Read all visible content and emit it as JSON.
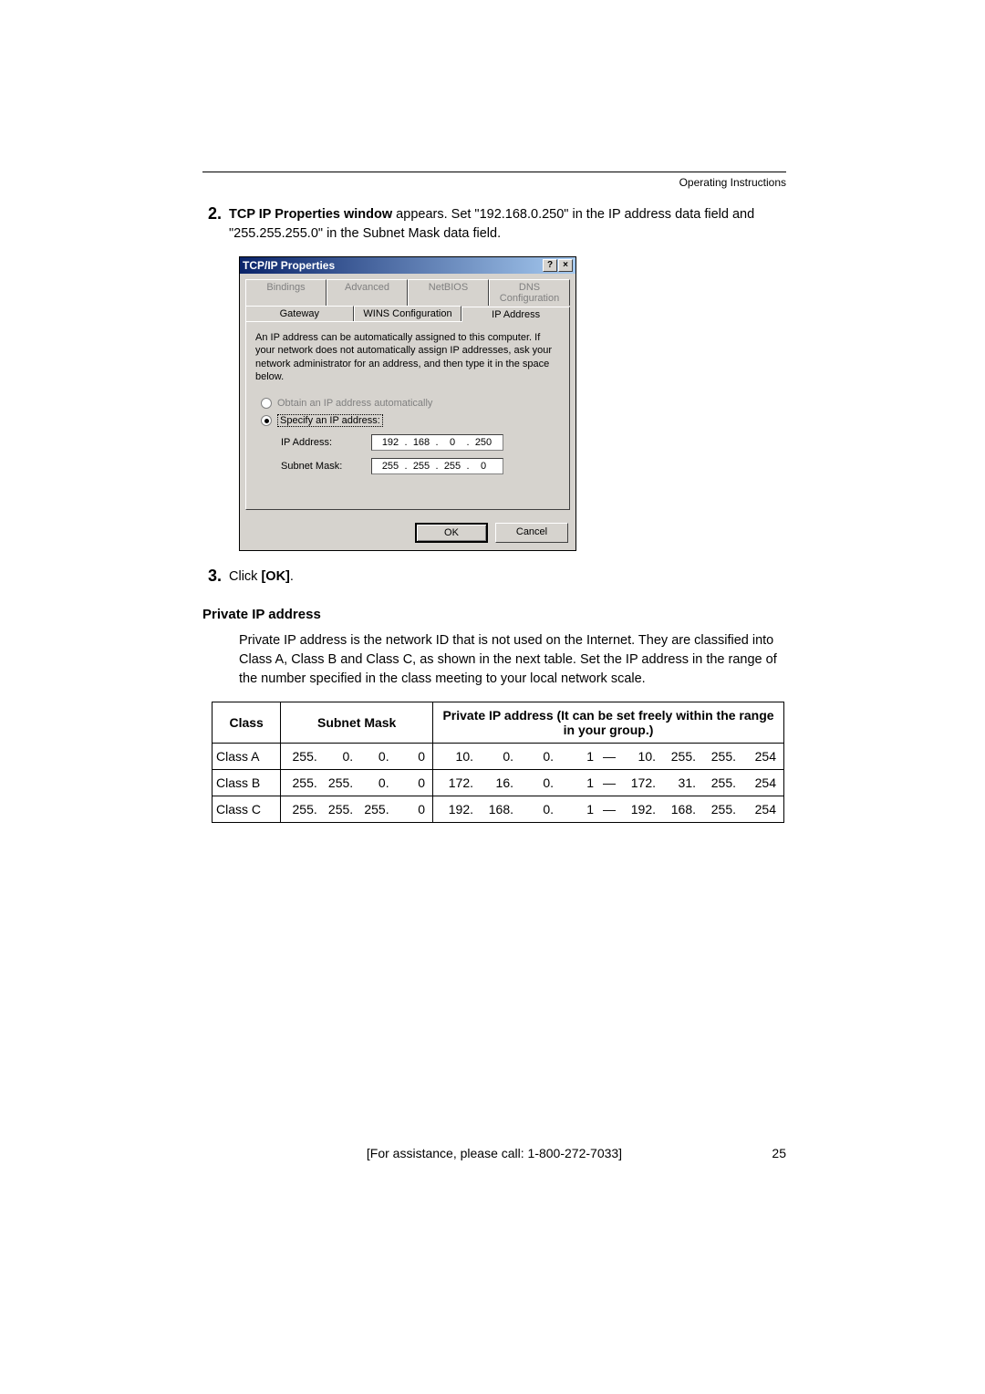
{
  "header": {
    "label": "Operating Instructions"
  },
  "step2": {
    "num": "2.",
    "bold": "TCP IP Properties window",
    "rest": " appears. Set \"192.168.0.250\" in the IP address data field and \"255.255.255.0\" in the Subnet Mask data field."
  },
  "dialog": {
    "title": "TCP/IP Properties",
    "help_glyph": "?",
    "close_glyph": "×",
    "tabs_back": [
      "Bindings",
      "Advanced",
      "NetBIOS",
      "DNS Configuration"
    ],
    "tabs_front": [
      "Gateway",
      "WINS Configuration",
      "IP Address"
    ],
    "desc": "An IP address can be automatically assigned to this computer. If your network does not automatically assign IP addresses, ask your network administrator for an address, and then type it in the space below.",
    "radio_auto": "Obtain an IP address automatically",
    "radio_spec": "Specify an IP address:",
    "ip_label": "IP Address:",
    "ip_vals": [
      "192",
      "168",
      "0",
      "250"
    ],
    "mask_label": "Subnet Mask:",
    "mask_vals": [
      "255",
      "255",
      "255",
      "0"
    ],
    "ok": "OK",
    "cancel": "Cancel"
  },
  "step3": {
    "num": "3.",
    "text_pre": "Click ",
    "bold": "[OK]",
    "text_post": "."
  },
  "section": {
    "heading": "Private IP address",
    "para": "Private IP address is the network ID that is not used on the Internet. They are classified into Class A, Class B and Class C, as shown in the next table. Set the IP address in the range of the number specified in the class meeting to your local network scale."
  },
  "table": {
    "h_class": "Class",
    "h_mask": "Subnet Mask",
    "h_range": "Private IP address (It can be set freely within the range in your group.)",
    "rows": [
      {
        "cls": "Class A",
        "mask": [
          "255.",
          "0.",
          "0.",
          "0"
        ],
        "range": [
          "10.",
          "0.",
          "0.",
          "1",
          "—",
          "10.",
          "255.",
          "255.",
          "254"
        ]
      },
      {
        "cls": "Class B",
        "mask": [
          "255.",
          "255.",
          "0.",
          "0"
        ],
        "range": [
          "172.",
          "16.",
          "0.",
          "1",
          "—",
          "172.",
          "31.",
          "255.",
          "254"
        ]
      },
      {
        "cls": "Class C",
        "mask": [
          "255.",
          "255.",
          "255.",
          "0"
        ],
        "range": [
          "192.",
          "168.",
          "0.",
          "1",
          "—",
          "192.",
          "168.",
          "255.",
          "254"
        ]
      }
    ]
  },
  "footer": {
    "assist": "[For assistance, please call: 1-800-272-7033]",
    "page": "25"
  }
}
